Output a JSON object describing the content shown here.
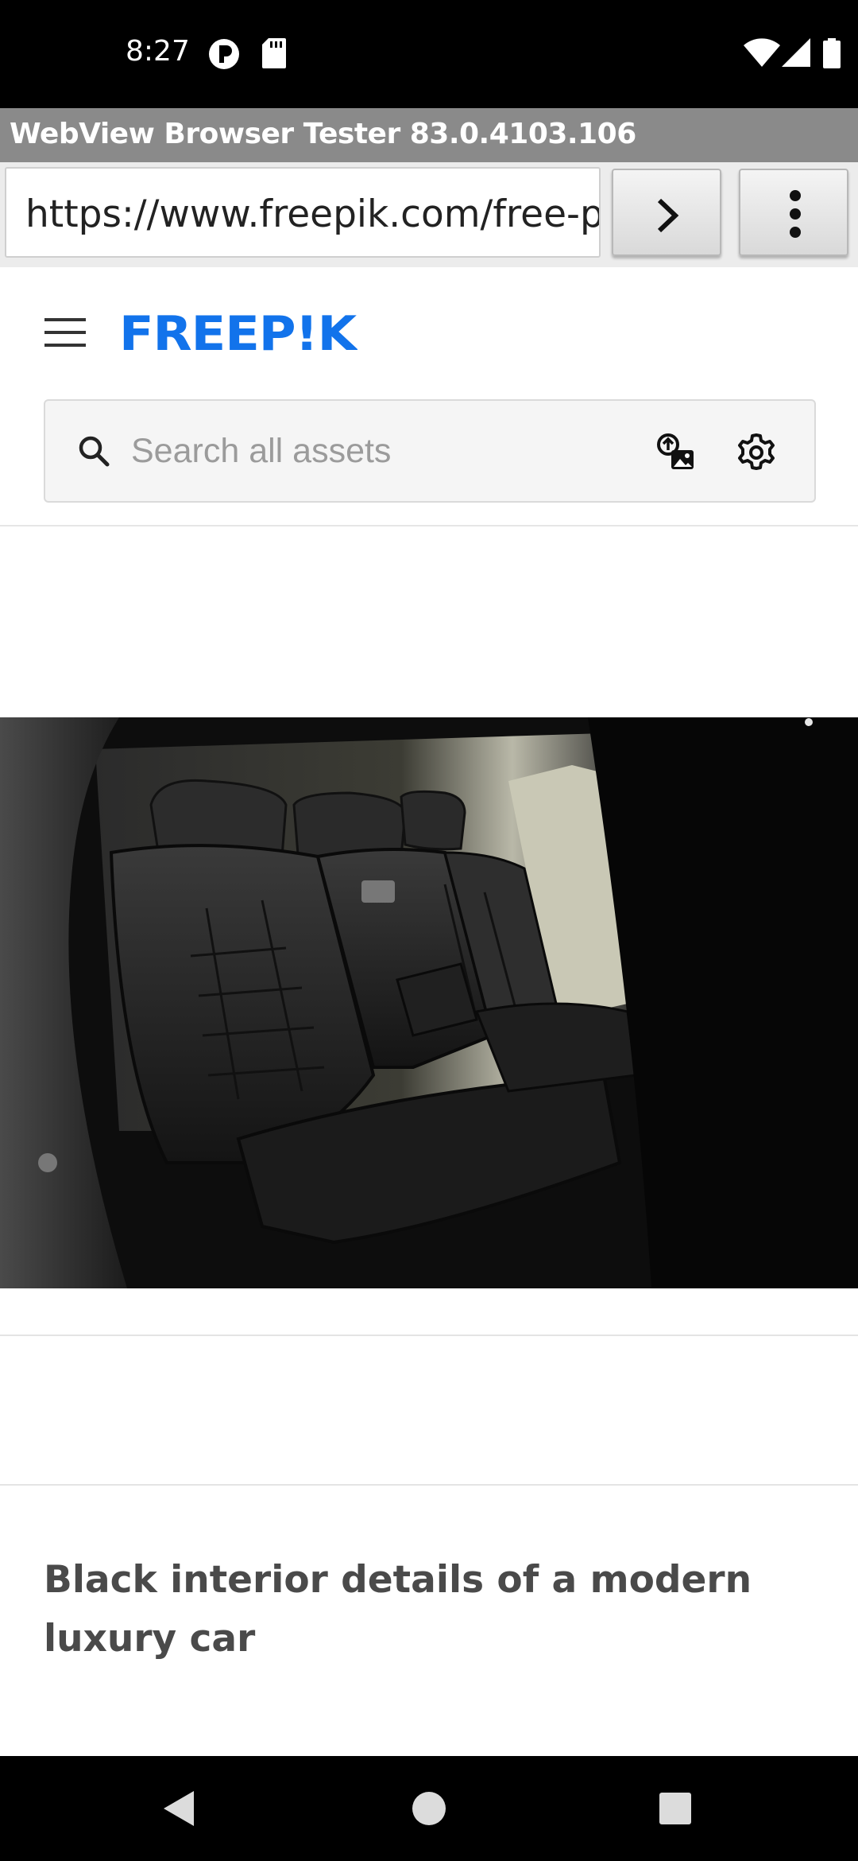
{
  "status_bar": {
    "time": "8:27",
    "left_icons": [
      "app-notification-icon",
      "sd-card-icon"
    ],
    "right_icons": [
      "wifi-icon",
      "cell-signal-icon",
      "battery-icon"
    ]
  },
  "browser": {
    "app_title": "WebView Browser Tester 83.0.4103.106",
    "url": "https://www.freepik.com/free-photo/black-interior-details-modern-luxury-car",
    "go_button_icon": "chevron-right-icon",
    "menu_button_icon": "more-vert-icon"
  },
  "site": {
    "logo_text": "FREEP!K",
    "menu_icon": "hamburger-menu-icon",
    "search": {
      "placeholder": "Search all assets",
      "search_icon": "search-icon",
      "image_search_icon": "image-search-icon",
      "settings_icon": "settings-icon"
    },
    "brand_color": "#1273eb"
  },
  "content": {
    "photo_subject": "car-rear-seat-photo",
    "title": "Black interior details of a modern luxury car"
  },
  "nav_bar": {
    "buttons": [
      "back-icon",
      "home-icon",
      "recents-icon"
    ]
  }
}
